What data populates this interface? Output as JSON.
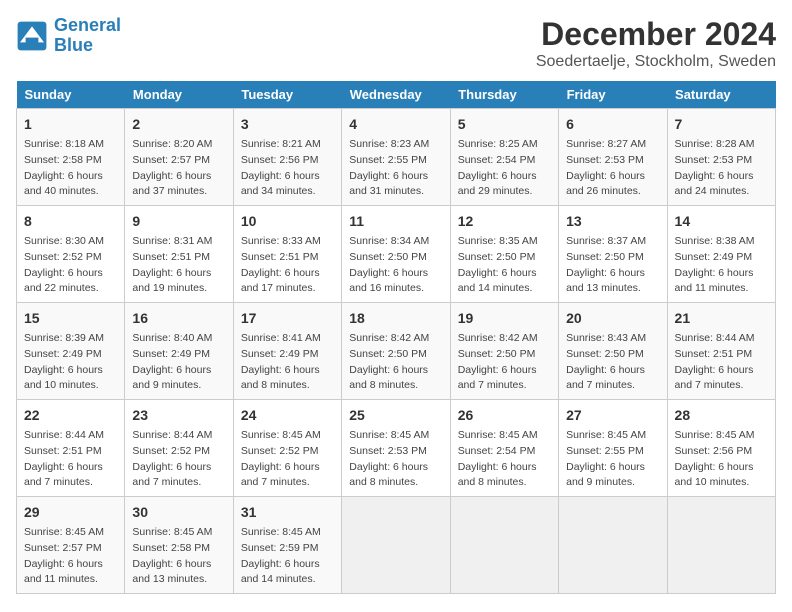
{
  "logo": {
    "line1": "General",
    "line2": "Blue"
  },
  "title": "December 2024",
  "subtitle": "Soedertaelje, Stockholm, Sweden",
  "header_color": "#2980b9",
  "weekdays": [
    "Sunday",
    "Monday",
    "Tuesday",
    "Wednesday",
    "Thursday",
    "Friday",
    "Saturday"
  ],
  "weeks": [
    [
      {
        "day": "1",
        "info": "Sunrise: 8:18 AM\nSunset: 2:58 PM\nDaylight: 6 hours\nand 40 minutes."
      },
      {
        "day": "2",
        "info": "Sunrise: 8:20 AM\nSunset: 2:57 PM\nDaylight: 6 hours\nand 37 minutes."
      },
      {
        "day": "3",
        "info": "Sunrise: 8:21 AM\nSunset: 2:56 PM\nDaylight: 6 hours\nand 34 minutes."
      },
      {
        "day": "4",
        "info": "Sunrise: 8:23 AM\nSunset: 2:55 PM\nDaylight: 6 hours\nand 31 minutes."
      },
      {
        "day": "5",
        "info": "Sunrise: 8:25 AM\nSunset: 2:54 PM\nDaylight: 6 hours\nand 29 minutes."
      },
      {
        "day": "6",
        "info": "Sunrise: 8:27 AM\nSunset: 2:53 PM\nDaylight: 6 hours\nand 26 minutes."
      },
      {
        "day": "7",
        "info": "Sunrise: 8:28 AM\nSunset: 2:53 PM\nDaylight: 6 hours\nand 24 minutes."
      }
    ],
    [
      {
        "day": "8",
        "info": "Sunrise: 8:30 AM\nSunset: 2:52 PM\nDaylight: 6 hours\nand 22 minutes."
      },
      {
        "day": "9",
        "info": "Sunrise: 8:31 AM\nSunset: 2:51 PM\nDaylight: 6 hours\nand 19 minutes."
      },
      {
        "day": "10",
        "info": "Sunrise: 8:33 AM\nSunset: 2:51 PM\nDaylight: 6 hours\nand 17 minutes."
      },
      {
        "day": "11",
        "info": "Sunrise: 8:34 AM\nSunset: 2:50 PM\nDaylight: 6 hours\nand 16 minutes."
      },
      {
        "day": "12",
        "info": "Sunrise: 8:35 AM\nSunset: 2:50 PM\nDaylight: 6 hours\nand 14 minutes."
      },
      {
        "day": "13",
        "info": "Sunrise: 8:37 AM\nSunset: 2:50 PM\nDaylight: 6 hours\nand 13 minutes."
      },
      {
        "day": "14",
        "info": "Sunrise: 8:38 AM\nSunset: 2:49 PM\nDaylight: 6 hours\nand 11 minutes."
      }
    ],
    [
      {
        "day": "15",
        "info": "Sunrise: 8:39 AM\nSunset: 2:49 PM\nDaylight: 6 hours\nand 10 minutes."
      },
      {
        "day": "16",
        "info": "Sunrise: 8:40 AM\nSunset: 2:49 PM\nDaylight: 6 hours\nand 9 minutes."
      },
      {
        "day": "17",
        "info": "Sunrise: 8:41 AM\nSunset: 2:49 PM\nDaylight: 6 hours\nand 8 minutes."
      },
      {
        "day": "18",
        "info": "Sunrise: 8:42 AM\nSunset: 2:50 PM\nDaylight: 6 hours\nand 8 minutes."
      },
      {
        "day": "19",
        "info": "Sunrise: 8:42 AM\nSunset: 2:50 PM\nDaylight: 6 hours\nand 7 minutes."
      },
      {
        "day": "20",
        "info": "Sunrise: 8:43 AM\nSunset: 2:50 PM\nDaylight: 6 hours\nand 7 minutes."
      },
      {
        "day": "21",
        "info": "Sunrise: 8:44 AM\nSunset: 2:51 PM\nDaylight: 6 hours\nand 7 minutes."
      }
    ],
    [
      {
        "day": "22",
        "info": "Sunrise: 8:44 AM\nSunset: 2:51 PM\nDaylight: 6 hours\nand 7 minutes."
      },
      {
        "day": "23",
        "info": "Sunrise: 8:44 AM\nSunset: 2:52 PM\nDaylight: 6 hours\nand 7 minutes."
      },
      {
        "day": "24",
        "info": "Sunrise: 8:45 AM\nSunset: 2:52 PM\nDaylight: 6 hours\nand 7 minutes."
      },
      {
        "day": "25",
        "info": "Sunrise: 8:45 AM\nSunset: 2:53 PM\nDaylight: 6 hours\nand 8 minutes."
      },
      {
        "day": "26",
        "info": "Sunrise: 8:45 AM\nSunset: 2:54 PM\nDaylight: 6 hours\nand 8 minutes."
      },
      {
        "day": "27",
        "info": "Sunrise: 8:45 AM\nSunset: 2:55 PM\nDaylight: 6 hours\nand 9 minutes."
      },
      {
        "day": "28",
        "info": "Sunrise: 8:45 AM\nSunset: 2:56 PM\nDaylight: 6 hours\nand 10 minutes."
      }
    ],
    [
      {
        "day": "29",
        "info": "Sunrise: 8:45 AM\nSunset: 2:57 PM\nDaylight: 6 hours\nand 11 minutes."
      },
      {
        "day": "30",
        "info": "Sunrise: 8:45 AM\nSunset: 2:58 PM\nDaylight: 6 hours\nand 13 minutes."
      },
      {
        "day": "31",
        "info": "Sunrise: 8:45 AM\nSunset: 2:59 PM\nDaylight: 6 hours\nand 14 minutes."
      },
      {
        "day": "",
        "info": ""
      },
      {
        "day": "",
        "info": ""
      },
      {
        "day": "",
        "info": ""
      },
      {
        "day": "",
        "info": ""
      }
    ]
  ]
}
